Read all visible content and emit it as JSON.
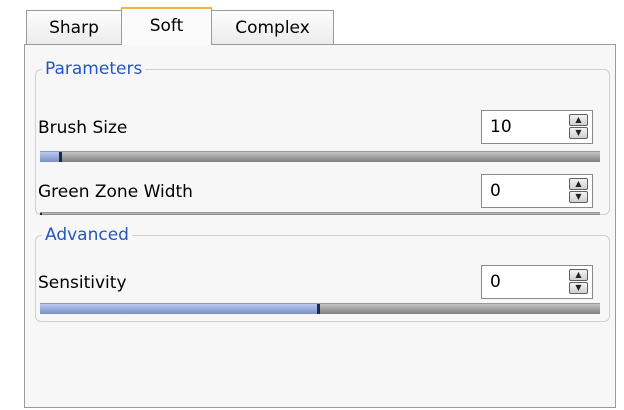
{
  "tabs": [
    {
      "label": "Sharp",
      "active": false
    },
    {
      "label": "Soft",
      "active": true
    },
    {
      "label": "Complex",
      "active": false
    }
  ],
  "groups": {
    "parameters": {
      "title": "Parameters",
      "fields": [
        {
          "label": "Brush Size",
          "value": "10",
          "fill_fraction": 0.04
        },
        {
          "label": "Green Zone Width",
          "value": "0",
          "fill_fraction": 0.0
        }
      ]
    },
    "advanced": {
      "title": "Advanced",
      "fields": [
        {
          "label": "Sensitivity",
          "value": "0",
          "fill_fraction": 0.5
        }
      ]
    }
  },
  "colors": {
    "group_title": "#2455c3",
    "active_tab_accent": "#f5b53b",
    "slider_fill": "#8a9dd0"
  },
  "icons": {
    "spin_up": "triangle-up",
    "spin_down": "triangle-down"
  }
}
